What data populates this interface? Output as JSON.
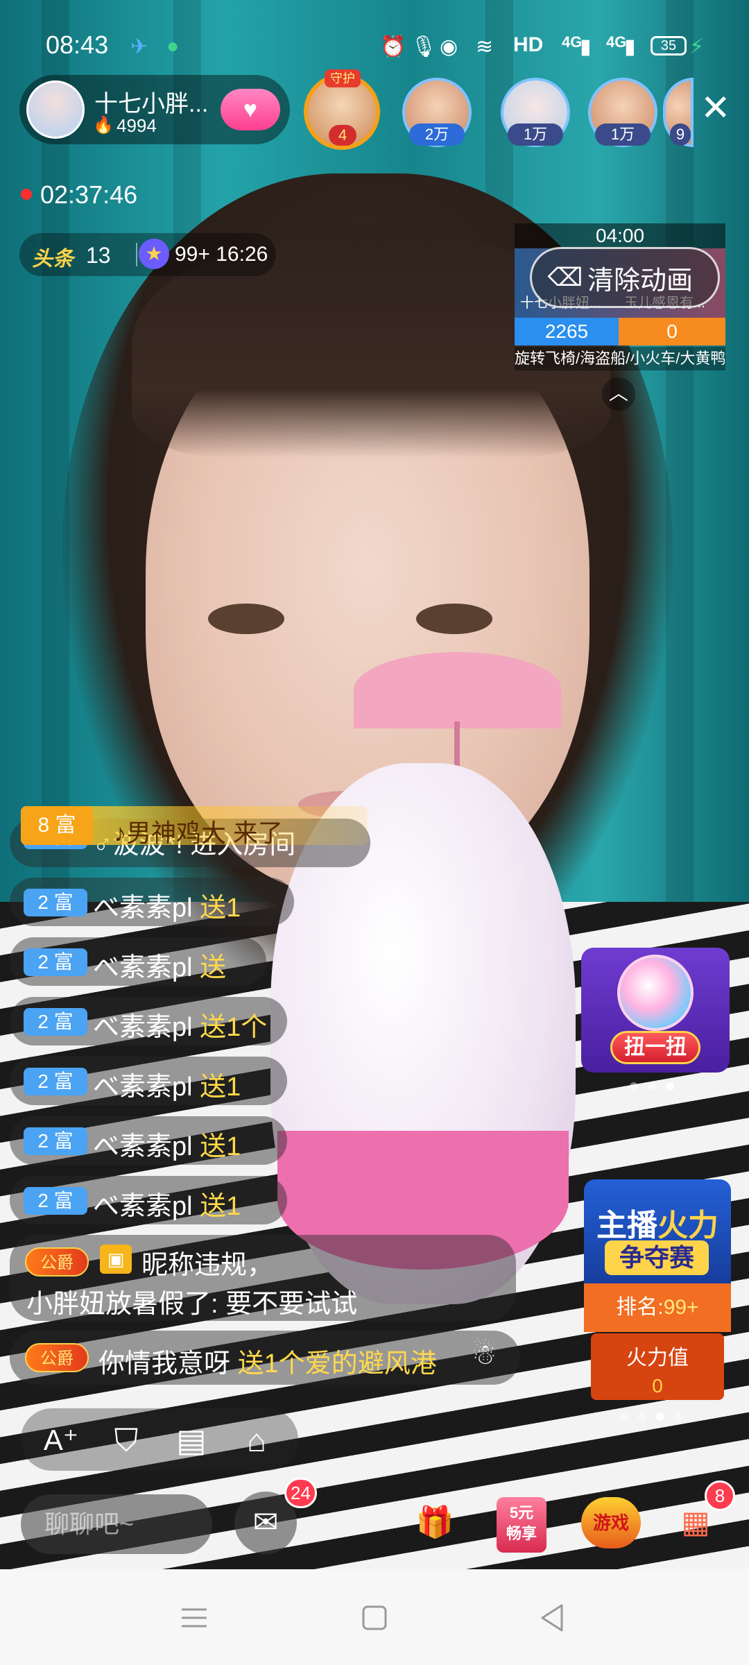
{
  "status_bar": {
    "time": "08:43",
    "network": "HD",
    "signal_1": "4G",
    "signal_2": "4G",
    "battery": "35"
  },
  "host": {
    "name": "十七小胖...",
    "heat": "4994",
    "follow_icon": "heart-icon"
  },
  "guard": {
    "tag": "守护",
    "count": "4"
  },
  "top_viewers": [
    {
      "badge": "2万"
    },
    {
      "badge": "1万"
    },
    {
      "badge": "1万"
    },
    {
      "badge": "9"
    }
  ],
  "live_timer": "02:37:46",
  "tags": {
    "toutiao_label": "头条",
    "toutiao_count": "13",
    "star_count": "99+",
    "star_time": "16:26"
  },
  "pk": {
    "countdown": "04:00",
    "left_name": "十七小胖妞...",
    "right_name": "玉儿感恩有...",
    "left_score": "2265",
    "right_score": "0",
    "tasks": "旋转飞椅/海盗船/小火车/大黄鸭礼"
  },
  "clear_animation_label": "清除动画",
  "enter_notice": {
    "badge": "8 富",
    "text": "♪男神鸡大 来了"
  },
  "chat": [
    {
      "badge": "2 富",
      "user": "♂波波*!",
      "text": "进入房间"
    },
    {
      "badge": "2 富",
      "user": "べ素素pl",
      "text": "送1"
    },
    {
      "badge": "2 富",
      "user": "べ素素pl",
      "text": "送"
    },
    {
      "badge": "2 富",
      "user": "べ素素pl",
      "text": "送1个"
    },
    {
      "badge": "2 富",
      "user": "べ素素pl",
      "text": "送1"
    },
    {
      "badge": "2 富",
      "user": "べ素素pl",
      "text": "送1"
    },
    {
      "badge": "2 富",
      "user": "べ素素pl",
      "text": "送1"
    }
  ],
  "chat_violation": {
    "badge": "公爵",
    "line1": "昵称违规，",
    "line2": "小胖妞放暑假了: 要不要试试"
  },
  "chat_last": {
    "badge": "公爵",
    "user": "你情我意呀",
    "gift": "送1个爱的避风港"
  },
  "niuyiniu_label": "扭一扭",
  "fire_contest": {
    "title_a": "主播",
    "title_b": "火力",
    "subtitle": "争夺赛",
    "rank_label": "排名:",
    "rank_value": "99+",
    "value_label": "火力值",
    "value": "0"
  },
  "tools": [
    "font-plus-icon",
    "guard-shield-icon",
    "task-list-icon",
    "tag-icon"
  ],
  "input_placeholder": "聊聊吧~",
  "messages_badge": "24",
  "five_yuan_label_1": "5元",
  "five_yuan_label_2": "畅享",
  "game_label": "游戏",
  "more_badge": "8",
  "colors": {
    "accent_pink": "#ff3f8f",
    "badge_blue": "#4aa3f3",
    "gold": "#ffd34a"
  }
}
